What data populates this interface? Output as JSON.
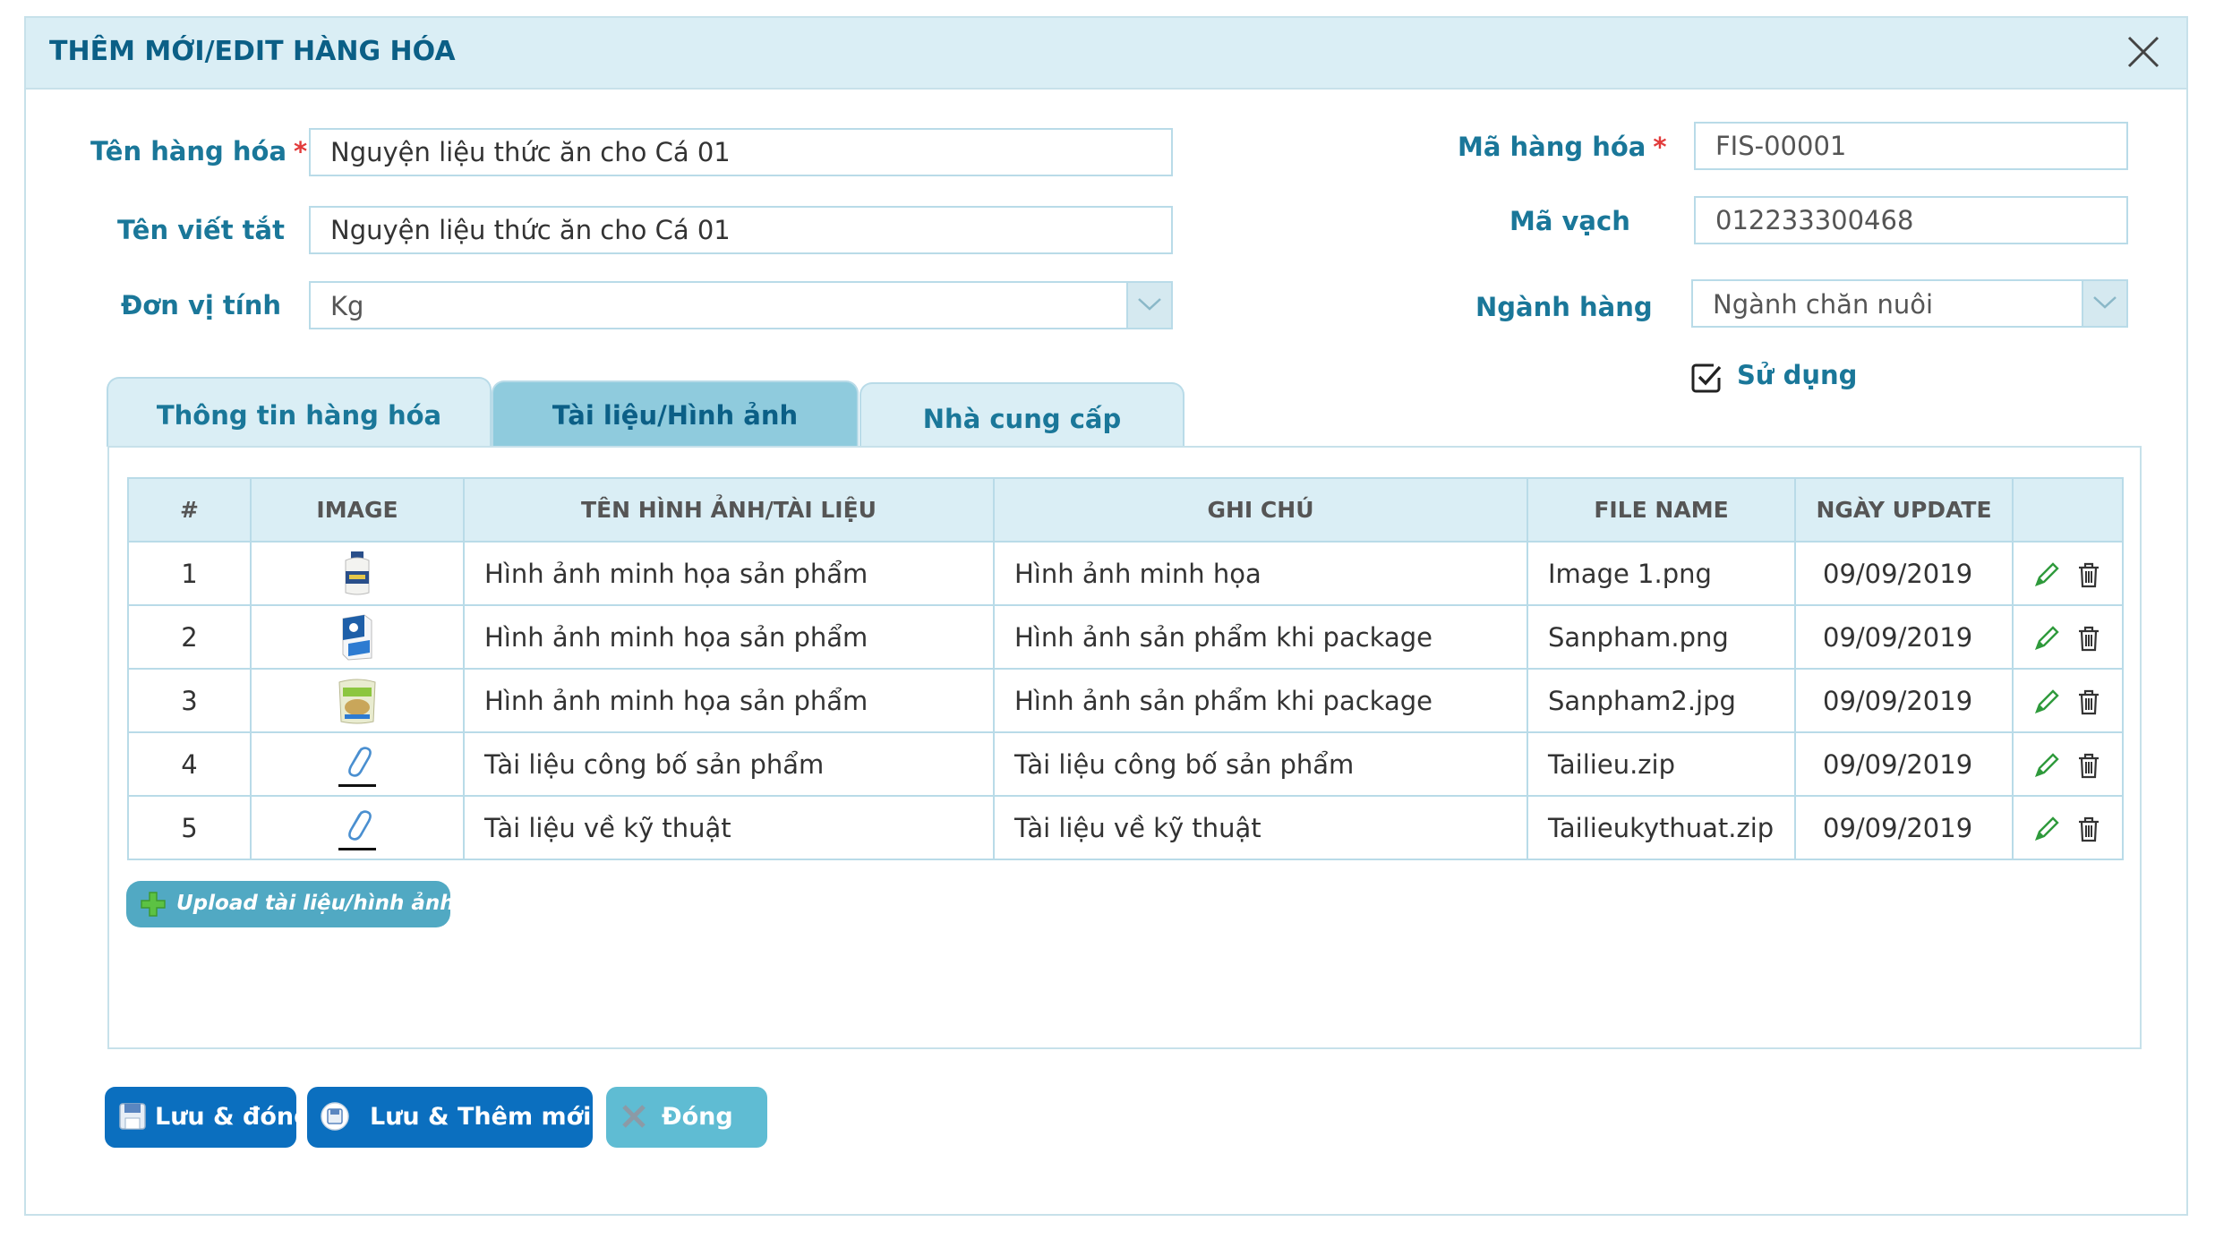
{
  "dialog": {
    "title": "THÊM MỚI/EDIT HÀNG HÓA"
  },
  "form": {
    "ten_hang_hoa": {
      "label": "Tên hàng hóa",
      "required_mark": "*",
      "value": "Nguyện liệu thức ăn cho Cá 01"
    },
    "ten_viet_tat": {
      "label": "Tên viết tắt",
      "value": "Nguyện liệu thức ăn cho Cá 01"
    },
    "don_vi_tinh": {
      "label": "Đơn vị tính",
      "value": "Kg"
    },
    "ma_hang_hoa": {
      "label": "Mã hàng hóa",
      "required_mark": "*",
      "value": "FIS-00001"
    },
    "ma_vach": {
      "label": "Mã vạch",
      "value": "012233300468"
    },
    "nganh_hang": {
      "label": "Ngành hàng",
      "value": "Ngành chăn nuôi"
    },
    "su_dung": {
      "label": "Sử dụng",
      "checked": true
    }
  },
  "tabs": [
    {
      "label": "Thông tin hàng hóa",
      "active": false
    },
    {
      "label": "Tài liệu/Hình ảnh",
      "active": true
    },
    {
      "label": "Nhà cung cấp",
      "active": false
    }
  ],
  "table": {
    "headers": [
      "#",
      "IMAGE",
      "TÊN HÌNH ẢNH/TÀI LIỆU",
      "GHI CHÚ",
      "FILE NAME",
      "NGÀY UPDATE",
      ""
    ],
    "rows": [
      {
        "num": "1",
        "image": "bottle-thumbnail",
        "name": "Hình ảnh minh họa sản phẩm",
        "note": "Hình ảnh minh họa",
        "file": "Image 1.png",
        "date": "09/09/2019"
      },
      {
        "num": "2",
        "image": "box-thumbnail",
        "name": "Hình ảnh minh họa sản phẩm",
        "note": "Hình ảnh sản phẩm khi package",
        "file": "Sanpham.png",
        "date": "09/09/2019"
      },
      {
        "num": "3",
        "image": "bag-thumbnail",
        "name": "Hình ảnh minh họa sản phẩm",
        "note": "Hình ảnh sản phẩm khi package",
        "file": "Sanpham2.jpg",
        "date": "09/09/2019"
      },
      {
        "num": "4",
        "image": "attachment-icon",
        "name": "Tài liệu công bố sản phẩm",
        "note": "Tài liệu công bố sản phẩm",
        "file": "Tailieu.zip",
        "date": "09/09/2019"
      },
      {
        "num": "5",
        "image": "attachment-icon",
        "name": "Tài liệu về kỹ thuật",
        "note": "Tài liệu về kỹ thuật",
        "file": "Tailieukythuat.zip",
        "date": "09/09/2019"
      }
    ]
  },
  "upload": {
    "label": "Upload tài liệu/hình ảnh"
  },
  "buttons": {
    "save_close": "Lưu & đóng",
    "save_new": "Lưu & Thêm mới",
    "close": "Đóng"
  },
  "colors": {
    "header_bg": "#daeef5",
    "label": "#1a7799",
    "required": "#e23b3b",
    "primary_button": "#0b6fbf",
    "secondary_button": "#5fbcd3",
    "upload_button": "#51a9c3"
  }
}
